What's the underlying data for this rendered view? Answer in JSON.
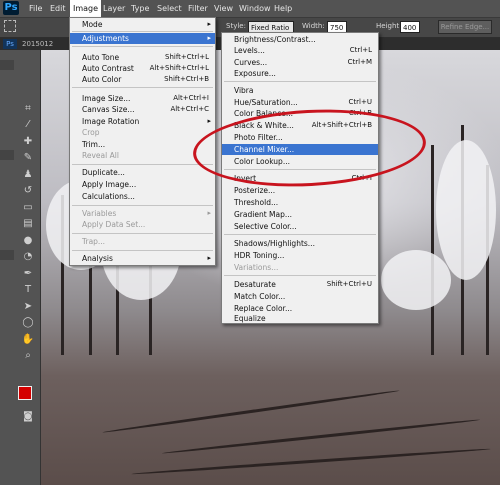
{
  "menubar": {
    "logo": "Ps",
    "items": [
      "File",
      "Edit",
      "Image",
      "Layer",
      "Type",
      "Select",
      "Filter",
      "View",
      "Window",
      "Help"
    ]
  },
  "options_bar": {
    "style_label": "Style:",
    "style_value": "Fixed Ratio",
    "width_label": "Width:",
    "width_value": "750",
    "height_label": "Height:",
    "height_value": "400",
    "refine_edge": "Refine Edge..."
  },
  "tabbar": {
    "tab_label": "2015012"
  },
  "image_menu": {
    "items": [
      {
        "label": "Mode",
        "shortcut": "",
        "submenu": true,
        "dim": false
      },
      {
        "label": "Adjustments",
        "shortcut": "",
        "submenu": true,
        "dim": false
      },
      {
        "label": "Auto Tone",
        "shortcut": "Shift+Ctrl+L",
        "submenu": false,
        "dim": false
      },
      {
        "label": "Auto Contrast",
        "shortcut": "Alt+Shift+Ctrl+L",
        "submenu": false,
        "dim": false
      },
      {
        "label": "Auto Color",
        "shortcut": "Shift+Ctrl+B",
        "submenu": false,
        "dim": false
      },
      {
        "label": "Image Size...",
        "shortcut": "Alt+Ctrl+I",
        "submenu": false,
        "dim": false
      },
      {
        "label": "Canvas Size...",
        "shortcut": "Alt+Ctrl+C",
        "submenu": false,
        "dim": false
      },
      {
        "label": "Image Rotation",
        "shortcut": "",
        "submenu": true,
        "dim": false
      },
      {
        "label": "Crop",
        "shortcut": "",
        "submenu": false,
        "dim": true
      },
      {
        "label": "Trim...",
        "shortcut": "",
        "submenu": false,
        "dim": false
      },
      {
        "label": "Reveal All",
        "shortcut": "",
        "submenu": false,
        "dim": true
      },
      {
        "label": "Duplicate...",
        "shortcut": "",
        "submenu": false,
        "dim": false
      },
      {
        "label": "Apply Image...",
        "shortcut": "",
        "submenu": false,
        "dim": false
      },
      {
        "label": "Calculations...",
        "shortcut": "",
        "submenu": false,
        "dim": false
      },
      {
        "label": "Variables",
        "shortcut": "",
        "submenu": true,
        "dim": true
      },
      {
        "label": "Apply Data Set...",
        "shortcut": "",
        "submenu": false,
        "dim": true
      },
      {
        "label": "Trap...",
        "shortcut": "",
        "submenu": false,
        "dim": true
      },
      {
        "label": "Analysis",
        "shortcut": "",
        "submenu": true,
        "dim": false
      }
    ]
  },
  "adjustments_menu": {
    "items": [
      {
        "label": "Brightness/Contrast...",
        "shortcut": "",
        "dim": false
      },
      {
        "label": "Levels...",
        "shortcut": "Ctrl+L",
        "dim": false
      },
      {
        "label": "Curves...",
        "shortcut": "Ctrl+M",
        "dim": false
      },
      {
        "label": "Exposure...",
        "shortcut": "",
        "dim": false
      },
      {
        "label": "Vibra",
        "shortcut": "",
        "dim": false
      },
      {
        "label": "Hue/Saturation...",
        "shortcut": "Ctrl+U",
        "dim": false
      },
      {
        "label": "Color Balance...",
        "shortcut": "Ctrl+B",
        "dim": false
      },
      {
        "label": "Black & White...",
        "shortcut": "Alt+Shift+Ctrl+B",
        "dim": false
      },
      {
        "label": "Photo Filter...",
        "shortcut": "",
        "dim": false
      },
      {
        "label": "Channel Mixer...",
        "shortcut": "",
        "dim": false
      },
      {
        "label": "Color Lookup...",
        "shortcut": "",
        "dim": false
      },
      {
        "label": "Invert",
        "shortcut": "Ctrl+I",
        "dim": false
      },
      {
        "label": "Posterize...",
        "shortcut": "",
        "dim": false
      },
      {
        "label": "Threshold...",
        "shortcut": "",
        "dim": false
      },
      {
        "label": "Gradient Map...",
        "shortcut": "",
        "dim": false
      },
      {
        "label": "Selective Color...",
        "shortcut": "",
        "dim": false
      },
      {
        "label": "Shadows/Highlights...",
        "shortcut": "",
        "dim": false
      },
      {
        "label": "HDR Toning...",
        "shortcut": "",
        "dim": false
      },
      {
        "label": "Variations...",
        "shortcut": "",
        "dim": true
      },
      {
        "label": "Desaturate",
        "shortcut": "Shift+Ctrl+U",
        "dim": false
      },
      {
        "label": "Match Color...",
        "shortcut": "",
        "dim": false
      },
      {
        "label": "Replace Color...",
        "shortcut": "",
        "dim": false
      },
      {
        "label": "Equalize",
        "shortcut": "",
        "dim": false
      }
    ]
  },
  "colors": {
    "highlight": "#3a74d0",
    "annotation": "#c8141e",
    "foreground_swatch": "#d40000"
  }
}
